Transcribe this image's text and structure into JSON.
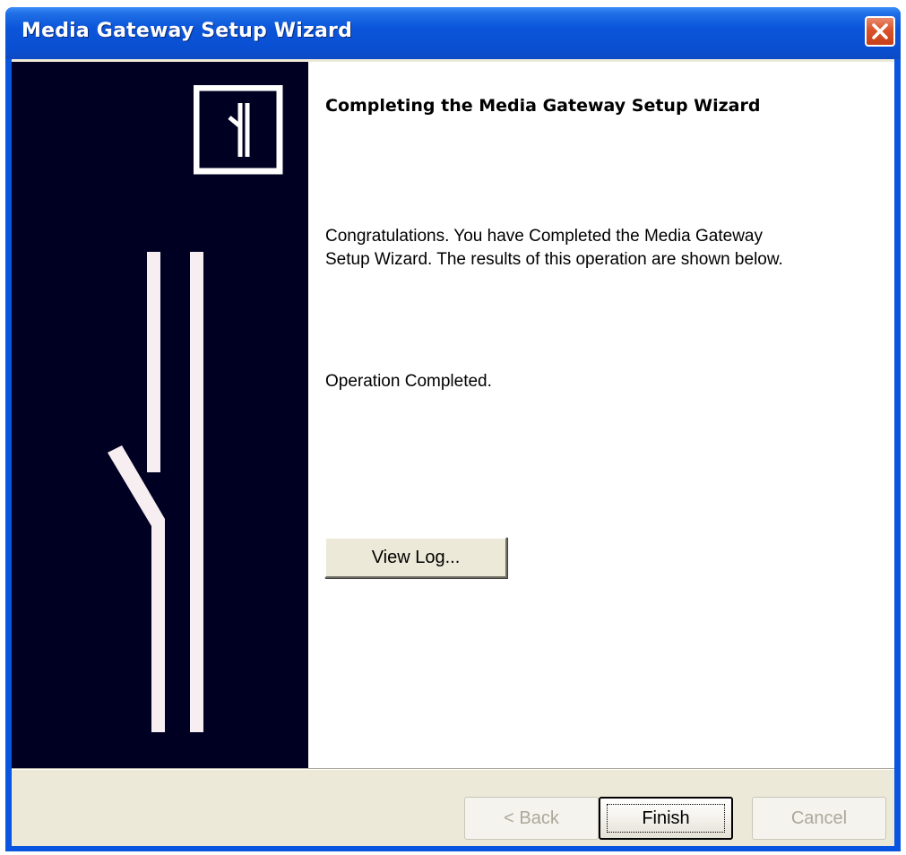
{
  "window": {
    "title": "Media Gateway Setup Wizard"
  },
  "icons": {
    "close": "close-icon",
    "logo": "gateway-logo-icon",
    "banner": "gateway-banner-graphic"
  },
  "content": {
    "heading": "Completing the Media Gateway Setup Wizard",
    "line1": "Congratulations. You have Completed the Media Gateway",
    "line2": "Setup Wizard. The results of this operation are shown below.",
    "status": "Operation Completed.",
    "view_log_label": "View Log..."
  },
  "footer": {
    "back_label": "< Back",
    "finish_label": "Finish",
    "cancel_label": "Cancel"
  },
  "colors": {
    "titlebar": "#0a55e0",
    "banner_bg": "#000022",
    "face": "#ece9d8",
    "close": "#d9532a"
  }
}
